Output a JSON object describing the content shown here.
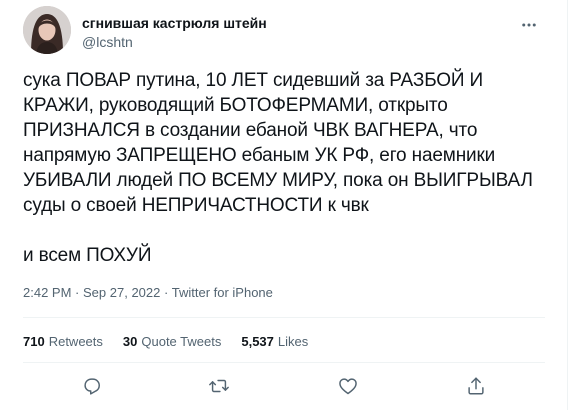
{
  "tweet": {
    "display_name": "сгнившая кастрюля штейн",
    "handle": "@lcshtn",
    "text": "сука ПОВАР путина, 10 ЛЕТ сидевший за РАЗБОЙ И КРАЖИ, руководящий БОТОФЕРМАМИ, открыто ПРИЗНАЛСЯ в создании ебаной ЧВК ВАГНЕРА, что напрямую ЗАПРЕЩЕНО ебаным УК РФ, его наемники УБИВАЛИ людей ПО ВСЕМУ МИРУ, пока он ВЫИГРЫВАЛ суды о своей НЕПРИЧАСТНОСТИ к чвк\n\nи всем ПОХУЙ",
    "time": "2:42 PM",
    "dot": "·",
    "date": "Sep 27, 2022",
    "source": "Twitter for iPhone"
  },
  "stats": {
    "retweets_count": "710",
    "retweets_label": "Retweets",
    "quotes_count": "30",
    "quotes_label": "Quote Tweets",
    "likes_count": "5,537",
    "likes_label": "Likes"
  },
  "icons": {
    "more": "more-horizontal-icon",
    "reply": "reply-icon",
    "retweet": "retweet-icon",
    "like": "heart-icon",
    "share": "share-icon"
  },
  "colors": {
    "text_primary": "#0f1419",
    "text_secondary": "#536471",
    "divider": "#eff3f4"
  }
}
